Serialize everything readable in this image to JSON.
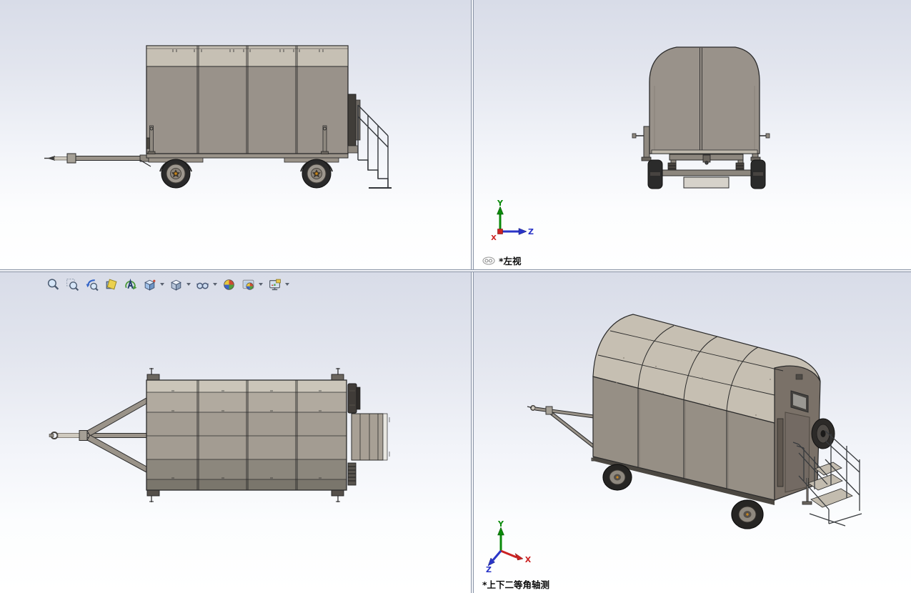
{
  "viewport_labels": {
    "top_right": "*左视",
    "bottom_right": "*上下二等角轴测"
  },
  "triad": {
    "x": "X",
    "y": "Y",
    "z": "Z"
  },
  "toolbar": {
    "items": [
      {
        "name": "zoom-to-fit",
        "dropdown": false
      },
      {
        "name": "zoom-to-area",
        "dropdown": false
      },
      {
        "name": "previous-view",
        "dropdown": false
      },
      {
        "name": "section-view",
        "dropdown": false
      },
      {
        "name": "dynamic-annotation-views",
        "dropdown": false
      },
      {
        "name": "view-orientation",
        "dropdown": true
      },
      {
        "name": "display-style",
        "dropdown": true
      },
      {
        "name": "hide-show-items",
        "dropdown": true
      },
      {
        "name": "edit-appearance",
        "dropdown": false
      },
      {
        "name": "apply-scene",
        "dropdown": true
      },
      {
        "name": "view-settings",
        "dropdown": true
      }
    ]
  },
  "colors": {
    "background_top": "#d8dce8",
    "background_bottom": "#ffffff",
    "body_side": "#99928a",
    "roof_band": "#c6bfb2",
    "rear_face": "#7a7168",
    "top_view_bands": [
      "#cbc5b9",
      "#b1aa9f",
      "#a39c92",
      "#a39c92",
      "#8c877d",
      "#7a766c"
    ],
    "tire": "#262523",
    "rim": "#9d978e",
    "hub_center": "#c8861f",
    "axis_x": "#cc2222",
    "axis_y": "#0a8a0a",
    "axis_z": "#2a35c8",
    "splitter": "#8a94a6"
  }
}
